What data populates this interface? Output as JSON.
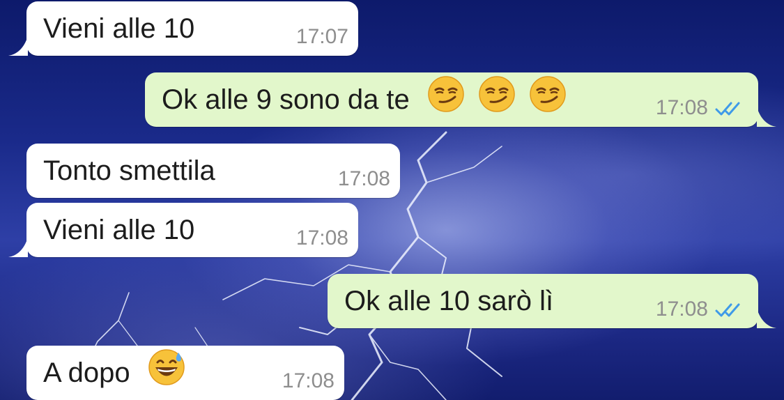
{
  "theme": {
    "incoming_bubble": "#ffffff",
    "outgoing_bubble": "#e2f7cb",
    "read_ticks": "#3f9ae8",
    "timestamp": "#8e8e8e"
  },
  "messages": [
    {
      "direction": "incoming",
      "text": "Vieni alle 10",
      "emoji": [],
      "time": "17:07"
    },
    {
      "direction": "outgoing",
      "text": "Ok alle 9 sono da te",
      "emoji": [
        "smirking-face",
        "smirking-face",
        "smirking-face"
      ],
      "time": "17:08",
      "status": "read"
    },
    {
      "direction": "incoming",
      "text": "Tonto smettila",
      "emoji": [],
      "time": "17:08"
    },
    {
      "direction": "incoming",
      "text": "Vieni alle 10",
      "emoji": [],
      "time": "17:08"
    },
    {
      "direction": "outgoing",
      "text": "Ok alle 10 sarò lì",
      "emoji": [],
      "time": "17:08",
      "status": "read"
    },
    {
      "direction": "incoming",
      "text": "A dopo",
      "emoji": [
        "grinning-face-with-sweat"
      ],
      "time": "17:08"
    }
  ]
}
